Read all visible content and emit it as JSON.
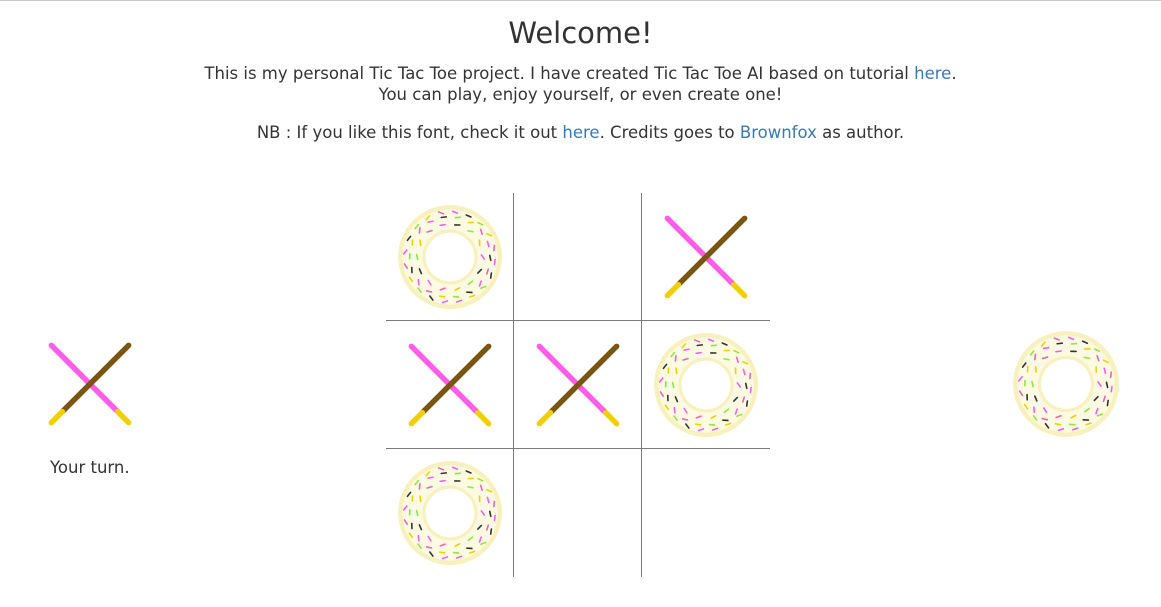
{
  "header": {
    "title": "Welcome!",
    "intro_text": "This is my personal Tic Tac Toe project. I have created Tic Tac Toe AI based on tutorial ",
    "intro_link": "here",
    "intro_tail": ".",
    "intro_line2": "You can play, enjoy yourself, or even create one!",
    "note_prefix": "NB : If you like this font, check it out ",
    "note_link": "here",
    "note_middle": ". Credits goes to ",
    "note_author": "Brownfox",
    "note_suffix": " as author."
  },
  "board": {
    "cells": [
      "O",
      "",
      "X",
      "X",
      "X",
      "O",
      "O",
      "",
      ""
    ]
  },
  "players": {
    "human_marker": "X",
    "ai_marker": "O",
    "turn_text": "Your turn."
  },
  "colors": {
    "link": "#3a78b0",
    "grid_line": "#7a7a7a",
    "pocky_pink": "#ff5ce8",
    "pocky_chocolate": "#7a5412",
    "pocky_tip": "#f0d000",
    "donut_dough": "#f8f1bd",
    "donut_glaze": "#fdfae3",
    "sprinkles": [
      "#ff5ce8",
      "#333333",
      "#8ee83a",
      "#f0d000",
      "#e868b0"
    ]
  },
  "icons": {
    "x_marker": "pocky-cross-icon",
    "o_marker": "sprinkle-donut-icon"
  }
}
